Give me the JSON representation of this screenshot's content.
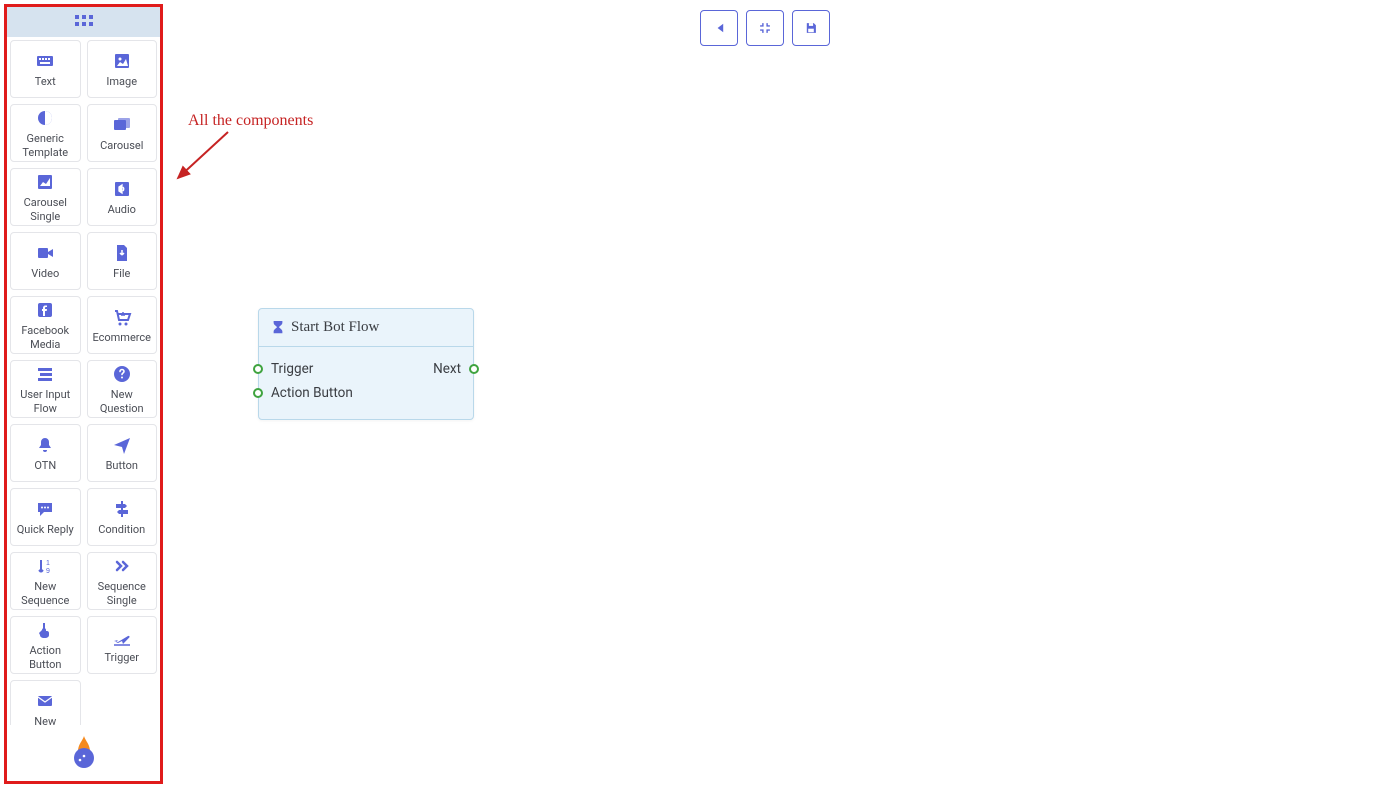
{
  "sidebar": {
    "components": [
      {
        "label": "Text",
        "icon": "keyboard"
      },
      {
        "label": "Image",
        "icon": "image"
      },
      {
        "label": "Generic Template",
        "icon": "contrast"
      },
      {
        "label": "Carousel",
        "icon": "images"
      },
      {
        "label": "Carousel Single",
        "icon": "image-alt"
      },
      {
        "label": "Audio",
        "icon": "audio"
      },
      {
        "label": "Video",
        "icon": "video"
      },
      {
        "label": "File",
        "icon": "file-download"
      },
      {
        "label": "Facebook Media",
        "icon": "facebook"
      },
      {
        "label": "Ecommerce",
        "icon": "cart"
      },
      {
        "label": "User Input Flow",
        "icon": "stream"
      },
      {
        "label": "New Question",
        "icon": "question"
      },
      {
        "label": "OTN",
        "icon": "bell"
      },
      {
        "label": "Button",
        "icon": "send"
      },
      {
        "label": "Quick Reply",
        "icon": "comment"
      },
      {
        "label": "Condition",
        "icon": "signpost"
      },
      {
        "label": "New Sequence",
        "icon": "sort-numeric"
      },
      {
        "label": "Sequence Single",
        "icon": "chevrons"
      },
      {
        "label": "Action Button",
        "icon": "tap"
      },
      {
        "label": "Trigger",
        "icon": "plane-depart"
      },
      {
        "label": "New",
        "icon": "envelope"
      }
    ]
  },
  "toolbar": {
    "buttons": [
      {
        "name": "reset-view-button",
        "icon": "skip-back"
      },
      {
        "name": "fit-view-button",
        "icon": "compress"
      },
      {
        "name": "save-button",
        "icon": "save"
      }
    ]
  },
  "annotation": {
    "text": "All the components"
  },
  "flow_node": {
    "title": "Start Bot Flow",
    "rows": [
      {
        "left_label": "Trigger",
        "right_label": "Next",
        "has_left_port": true,
        "has_right_port": true
      },
      {
        "left_label": "Action Button",
        "right_label": "",
        "has_left_port": true,
        "has_right_port": false
      }
    ]
  },
  "colors": {
    "accent": "#5a66d8",
    "highlight_border": "#e01b1b",
    "node_bg": "#eaf4fb",
    "node_border": "#b9d8ea",
    "port_border": "#3fa33f"
  }
}
